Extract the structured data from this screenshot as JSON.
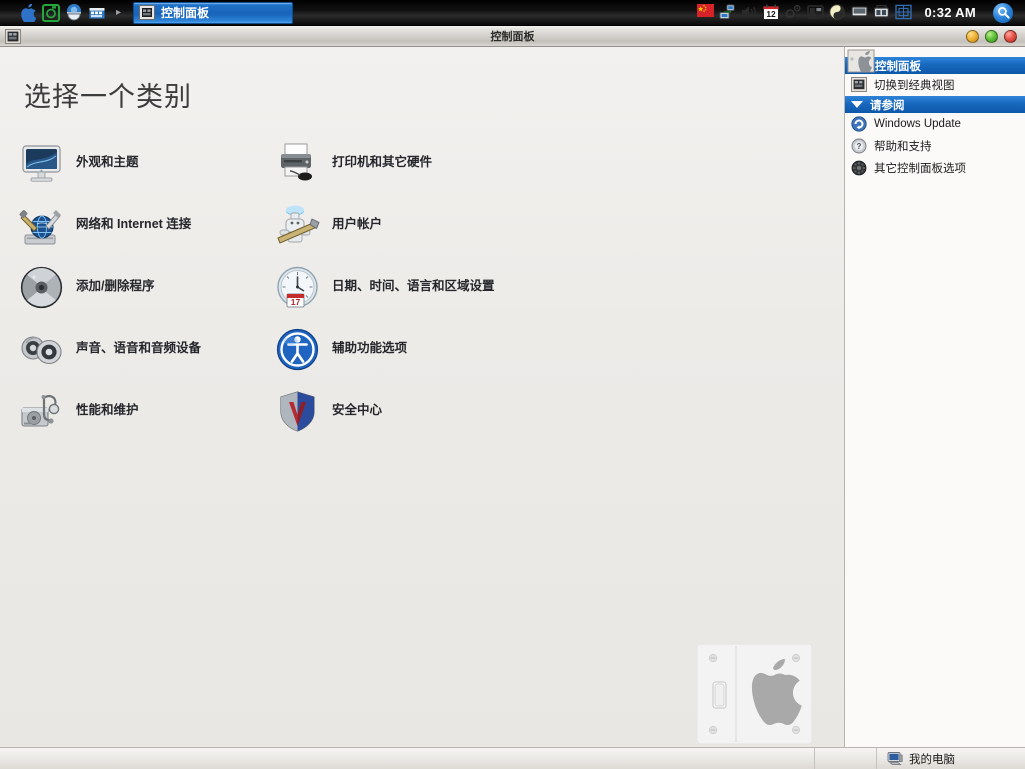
{
  "taskbar": {
    "quicklaunch": [
      {
        "name": "apple-icon",
        "label": "Apple"
      },
      {
        "name": "camera-icon",
        "label": "Camera"
      },
      {
        "name": "browser-icon",
        "label": "Browser"
      },
      {
        "name": "media-icon",
        "label": "Media"
      }
    ],
    "overflow_glyph": "▸",
    "window_button": {
      "label": "控制面板",
      "icon": "control-panel-icon",
      "active": true
    },
    "tray": [
      {
        "name": "language-flag-icon",
        "label": "中文"
      },
      {
        "name": "network-icon",
        "label": "网络"
      },
      {
        "name": "volume-icon",
        "label": "音量"
      },
      {
        "name": "calendar-12-icon",
        "label": "12"
      },
      {
        "name": "settings-icon",
        "label": "设置"
      },
      {
        "name": "display-icon",
        "label": "显示"
      },
      {
        "name": "yinyang-icon",
        "label": "主题"
      },
      {
        "name": "monitor-icon",
        "label": "监视器"
      },
      {
        "name": "update-icon",
        "label": "更新"
      },
      {
        "name": "ime-icon",
        "label": "输入法"
      }
    ],
    "clock": "0:32 AM",
    "spotlight": {
      "name": "spotlight-search-icon",
      "label": "搜索"
    }
  },
  "window": {
    "title": "控制面板",
    "icon": "control-panel-icon",
    "buttons": {
      "minimize": "最小化",
      "maximize": "最大化",
      "close": "关闭"
    }
  },
  "main": {
    "heading": "选择一个类别",
    "categories_col1": [
      {
        "label": "外观和主题",
        "icon": "display-monitor-icon"
      },
      {
        "label": "网络和 Internet 连接",
        "icon": "network-globe-icon"
      },
      {
        "label": "添加/删除程序",
        "icon": "add-remove-programs-icon"
      },
      {
        "label": "声音、语音和音频设备",
        "icon": "sound-speakers-icon"
      },
      {
        "label": "性能和维护",
        "icon": "performance-maintenance-icon"
      }
    ],
    "categories_col2": [
      {
        "label": "打印机和其它硬件",
        "icon": "printer-hardware-icon"
      },
      {
        "label": "用户帐户",
        "icon": "user-accounts-icon"
      },
      {
        "label": "日期、时间、语言和区域设置",
        "icon": "date-time-clock-icon"
      },
      {
        "label": "辅助功能选项",
        "icon": "accessibility-icon"
      },
      {
        "label": "安全中心",
        "icon": "security-center-shield-icon"
      }
    ],
    "watermark": {
      "name": "apple-switchplate-graphic",
      "label": "Apple 开关面板"
    }
  },
  "sidebar": {
    "panel_header": {
      "label": "控制面板",
      "icon": "control-panel-badge-icon"
    },
    "panel_items": [
      {
        "label": "切换到经典视图",
        "icon": "classic-view-icon"
      }
    ],
    "seealso_header": {
      "label": "请参阅",
      "icon": "chevron-down-icon"
    },
    "seealso_items": [
      {
        "label": "Windows Update",
        "icon": "windows-update-icon"
      },
      {
        "label": "帮助和支持",
        "icon": "help-support-icon"
      },
      {
        "label": "其它控制面板选项",
        "icon": "other-control-panel-icon"
      }
    ]
  },
  "statusbar": {
    "status_text": "我的电脑",
    "status_icon": "my-computer-icon"
  },
  "colors": {
    "accent_blue": "#1667bd",
    "taskbar_button": "#1763b8",
    "window_chrome": "#d2cfca",
    "pane_bg": "#edebe8",
    "sidebar_bg": "#fbfaf9"
  }
}
